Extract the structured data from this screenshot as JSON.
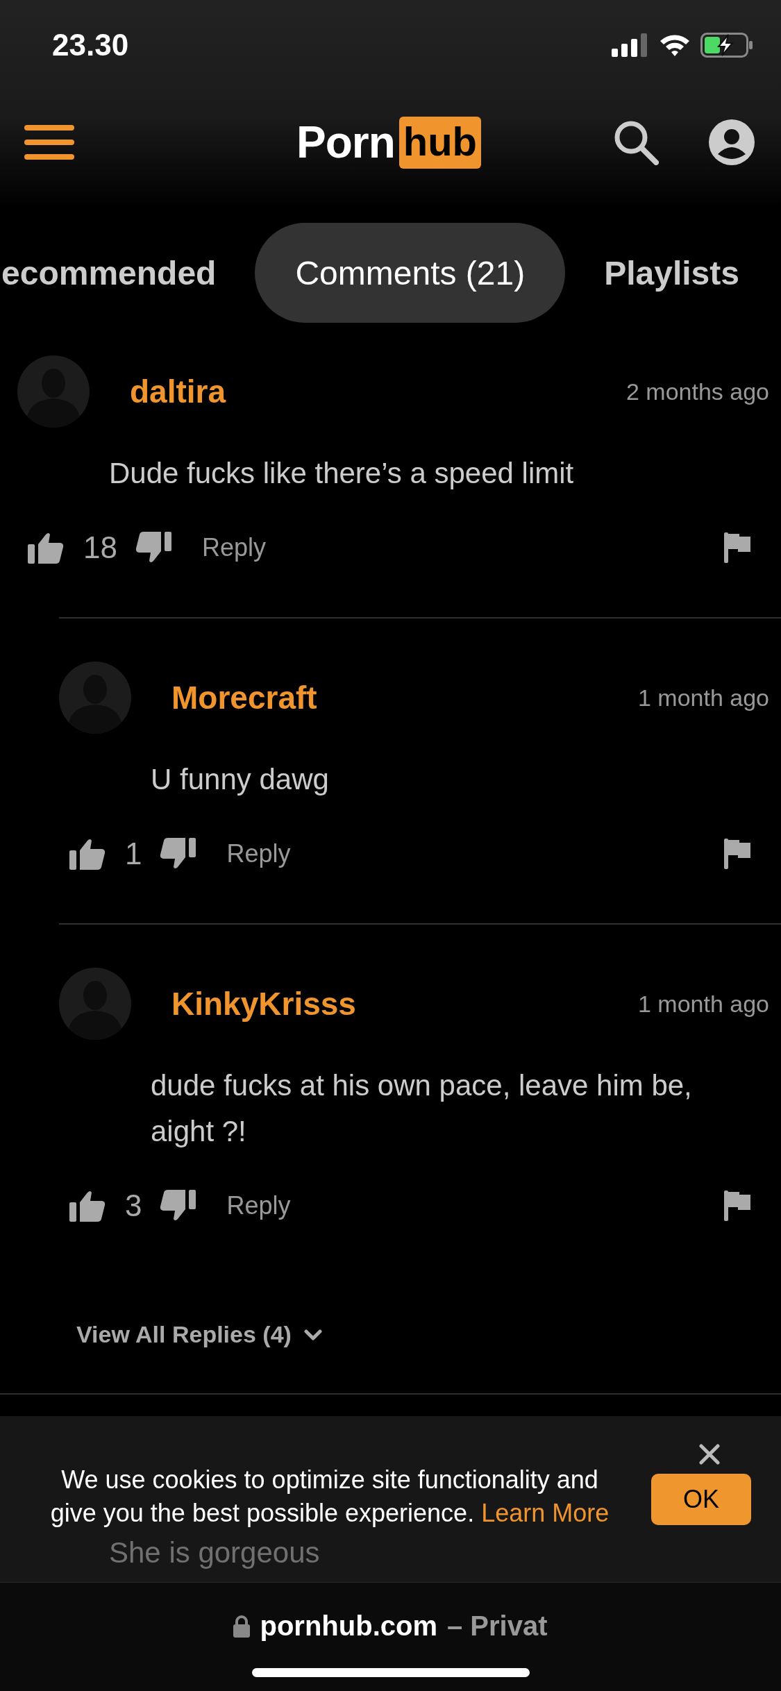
{
  "status_bar": {
    "time": "23.30"
  },
  "header": {
    "logo_left": "Porn",
    "logo_right": "hub"
  },
  "tabs": [
    {
      "label": "ecommended",
      "selected": false
    },
    {
      "label": "Comments (21)",
      "selected": true
    },
    {
      "label": "Playlists",
      "selected": false
    }
  ],
  "comments": [
    {
      "author": "daltira",
      "time": "2 months ago",
      "text": "Dude fucks like there’s a speed limit",
      "likes": "18",
      "reply_label": "Reply",
      "replies": [
        {
          "author": "Morecraft",
          "time": "1 month ago",
          "text": "U funny dawg",
          "likes": "1",
          "reply_label": "Reply"
        },
        {
          "author": "KinkyKrisss",
          "time": "1 month ago",
          "text": "dude fucks at his own pace, leave him be, aight ?!",
          "likes": "3",
          "reply_label": "Reply"
        }
      ]
    }
  ],
  "view_all_replies": "View All Replies (4)",
  "next_comment": {
    "text": "She is gorgeous"
  },
  "cookie_banner": {
    "text": "We use cookies to optimize site functionality and give you the best possible experience.",
    "link": "Learn More",
    "button": "OK"
  },
  "url_bar": {
    "domain": "pornhub.com",
    "suffix": "– Privat"
  }
}
